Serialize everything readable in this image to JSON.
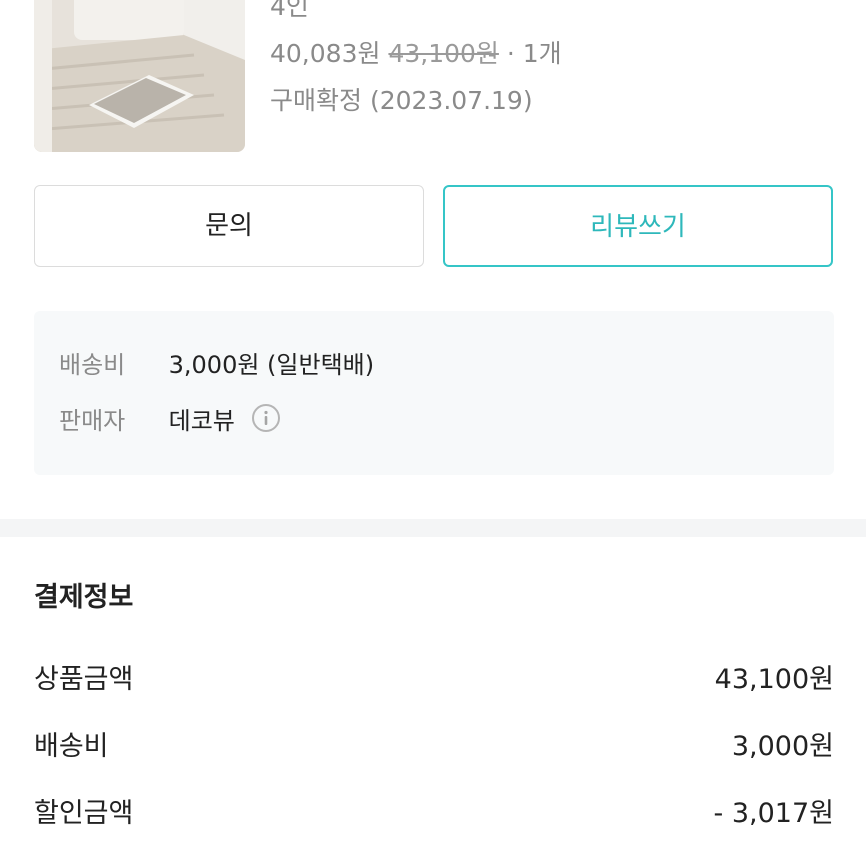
{
  "order_item": {
    "option_text": "4인",
    "sale_price": "40,083원",
    "original_price": "43,100원",
    "quantity": "· 1개",
    "status": "구매확정 (2023.07.19)"
  },
  "actions": {
    "inquiry_label": "문의",
    "review_label": "리뷰쓰기"
  },
  "shipping_info": {
    "fee_label": "배송비",
    "fee_value": "3,000원 (일반택배)",
    "seller_label": "판매자",
    "seller_value": "데코뷰"
  },
  "payment": {
    "title": "결제정보",
    "rows": [
      {
        "label": "상품금액",
        "value": "43,100원"
      },
      {
        "label": "배송비",
        "value": "3,000원"
      },
      {
        "label": "할인금액",
        "value": "- 3,017원"
      }
    ]
  },
  "colors": {
    "accent": "#35c5c7",
    "muted_text": "#8a8a8a",
    "info_bg": "#f7f9fa"
  },
  "icons": {
    "seller_info": "info-circle-icon"
  }
}
